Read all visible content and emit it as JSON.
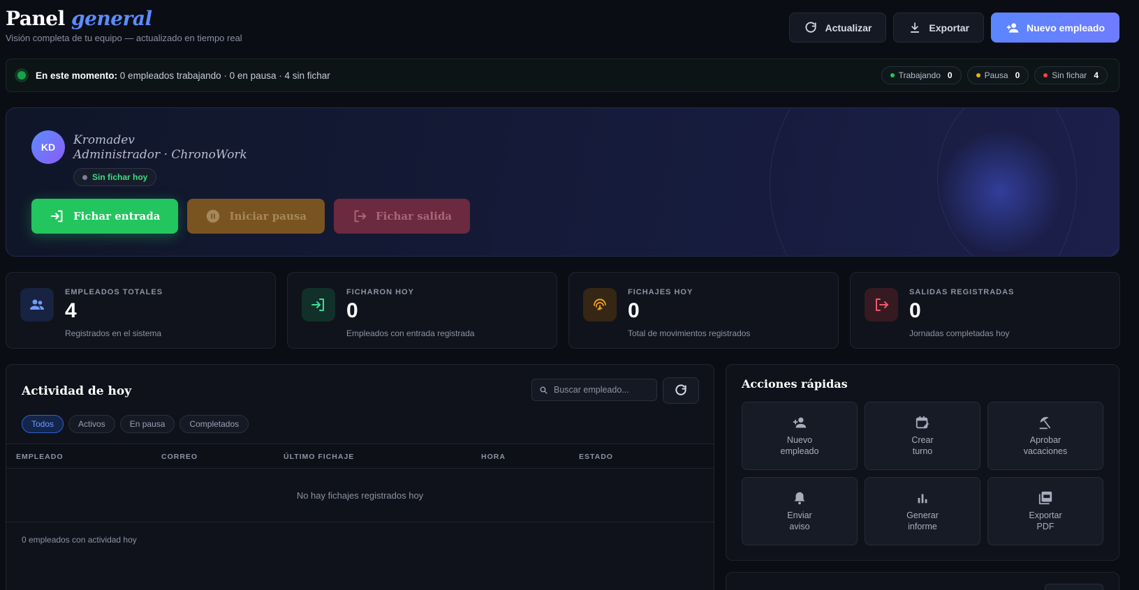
{
  "header": {
    "title_main": "Panel",
    "title_accent": "general",
    "subtitle": "Visión completa de tu equipo — actualizado en tiempo real",
    "refresh_label": "Actualizar",
    "export_label": "Exportar",
    "new_employee_label": "Nuevo empleado"
  },
  "status": {
    "lead": "En este momento:",
    "text": "0 empleados trabajando · 0 en pausa · 4 sin fichar",
    "pills": [
      {
        "label": "Trabajando",
        "value": "0",
        "color": "#22c55e"
      },
      {
        "label": "Pausa",
        "value": "0",
        "color": "#eab308"
      },
      {
        "label": "Sin fichar",
        "value": "4",
        "color": "#ef4444"
      }
    ]
  },
  "profile": {
    "initials": "KD",
    "name": "Kromadev",
    "role": "Administrador · ChronoWork",
    "badge": "Sin fichar hoy",
    "actions": {
      "clock_in": "Fichar entrada",
      "pause": "Iniciar pausa",
      "clock_out": "Fichar salida"
    }
  },
  "stats": [
    {
      "label": "EMPLEADOS TOTALES",
      "value": "4",
      "desc": "Registrados en el sistema",
      "icon": "users-icon",
      "color": "#5b8cff"
    },
    {
      "label": "FICHARON HOY",
      "value": "0",
      "desc": "Empleados con entrada registrada",
      "icon": "login-icon",
      "color": "#22c55e"
    },
    {
      "label": "FICHAJES HOY",
      "value": "0",
      "desc": "Total de movimientos registrados",
      "icon": "fingerprint-icon",
      "color": "#f59e0b"
    },
    {
      "label": "SALIDAS REGISTRADAS",
      "value": "0",
      "desc": "Jornadas completadas hoy",
      "icon": "logout-icon",
      "color": "#ef4444"
    }
  ],
  "activity": {
    "title": "Actividad de hoy",
    "search_placeholder": "Buscar empleado...",
    "filters": [
      "Todos",
      "Activos",
      "En pausa",
      "Completados"
    ],
    "columns": [
      "EMPLEADO",
      "CORREO",
      "ÚLTIMO FICHAJE",
      "HORA",
      "ESTADO"
    ],
    "empty": "No hay fichajes registrados hoy",
    "footer": "0 empleados con actividad hoy"
  },
  "quick_actions": {
    "title": "Acciones rápidas",
    "items": [
      {
        "label": "Nuevo\nempleado",
        "icon": "add-user-icon"
      },
      {
        "label": "Crear\nturno",
        "icon": "calendar-edit-icon"
      },
      {
        "label": "Aprobar\nvacaciones",
        "icon": "beach-umbrella-icon"
      },
      {
        "label": "Enviar\naviso",
        "icon": "bell-icon"
      },
      {
        "label": "Generar\ninforme",
        "icon": "bar-chart-icon"
      },
      {
        "label": "Exportar\nPDF",
        "icon": "pdf-icon"
      }
    ]
  }
}
